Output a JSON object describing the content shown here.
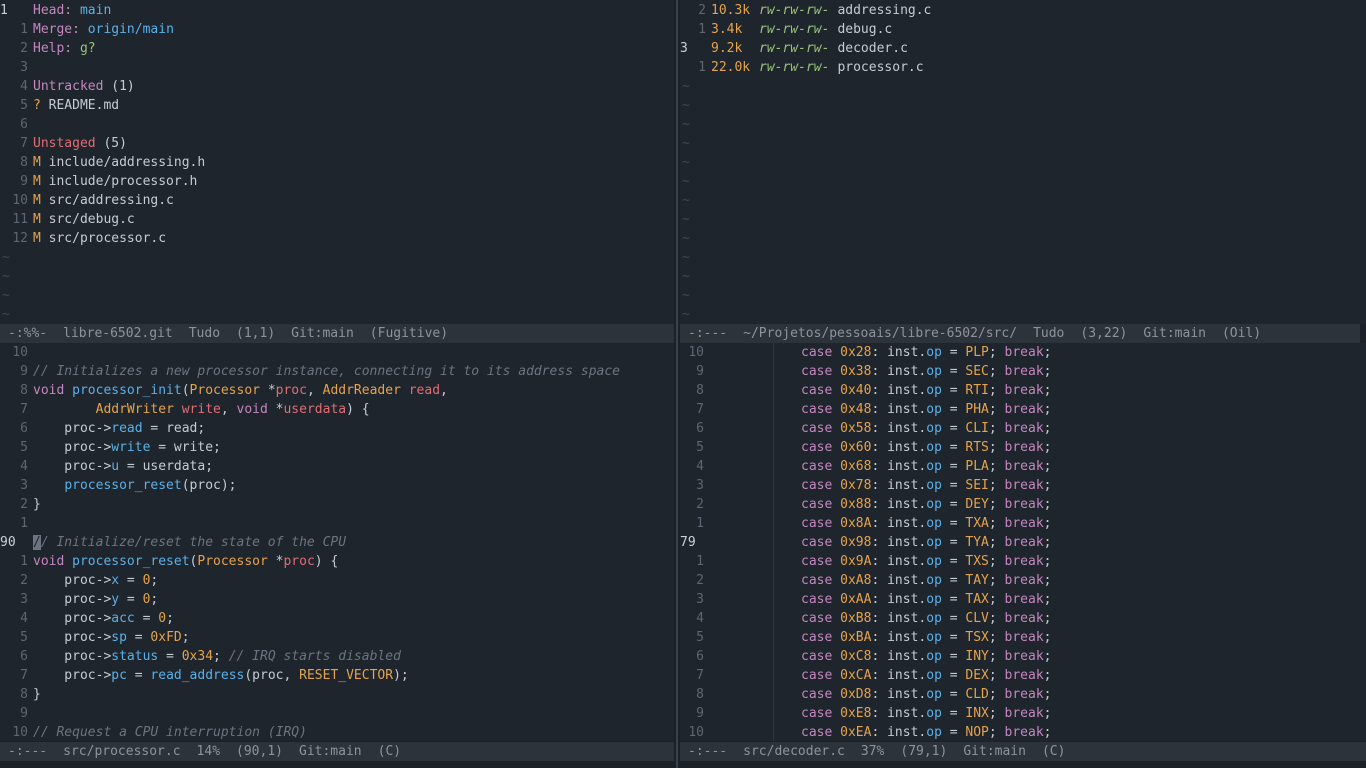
{
  "git_status": {
    "lines": [
      {
        "num": "1",
        "current": true,
        "parts": [
          [
            "c-key",
            "Head: "
          ],
          [
            "c-blue",
            "main"
          ]
        ]
      },
      {
        "num": "1",
        "parts": [
          [
            "c-key",
            "Merge: "
          ],
          [
            "c-blue",
            "origin/main"
          ]
        ]
      },
      {
        "num": "2",
        "parts": [
          [
            "c-key",
            "Help: "
          ],
          [
            "c-green",
            "g?"
          ]
        ]
      },
      {
        "num": "3",
        "parts": []
      },
      {
        "num": "4",
        "parts": [
          [
            "c-key",
            "Untracked "
          ],
          [
            "code-text",
            "(1)"
          ]
        ]
      },
      {
        "num": "5",
        "parts": [
          [
            "c-orange",
            "? "
          ],
          [
            "code-text",
            "README.md"
          ]
        ]
      },
      {
        "num": "6",
        "parts": []
      },
      {
        "num": "7",
        "parts": [
          [
            "c-red",
            "Unstaged "
          ],
          [
            "code-text",
            "(5)"
          ]
        ]
      },
      {
        "num": "8",
        "parts": [
          [
            "c-orange",
            "M "
          ],
          [
            "code-text",
            "include/addressing.h"
          ]
        ]
      },
      {
        "num": "9",
        "parts": [
          [
            "c-orange",
            "M "
          ],
          [
            "code-text",
            "include/processor.h"
          ]
        ]
      },
      {
        "num": "10",
        "parts": [
          [
            "c-orange",
            "M "
          ],
          [
            "code-text",
            "src/addressing.c"
          ]
        ]
      },
      {
        "num": "11",
        "parts": [
          [
            "c-orange",
            "M "
          ],
          [
            "code-text",
            "src/debug.c"
          ]
        ]
      },
      {
        "num": "12",
        "parts": [
          [
            "c-orange",
            "M "
          ],
          [
            "code-text",
            "src/processor.c"
          ]
        ]
      }
    ],
    "tildes": 4,
    "modeline": [
      "-:%%-",
      "libre-6502.git",
      "Tudo",
      "(1,1)",
      "Git:main",
      "(Fugitive)"
    ]
  },
  "oil": {
    "lines": [
      {
        "num": "2",
        "size": "10.3k",
        "perm": "rw-rw-rw-",
        "name": "addressing.c"
      },
      {
        "num": "1",
        "size": "3.4k",
        "perm": "rw-rw-rw-",
        "name": "debug.c"
      },
      {
        "num": "3",
        "current": true,
        "size": "9.2k",
        "perm": "rw-rw-rw-",
        "name": "decoder.c"
      },
      {
        "num": "1",
        "size": "22.0k",
        "perm": "rw-rw-rw-",
        "name": "processor.c"
      }
    ],
    "tildes": 13,
    "modeline": [
      "-:---",
      "~/Projetos/pessoais/libre-6502/src/",
      "Tudo",
      "(3,22)",
      "Git:main",
      "(Oil)"
    ]
  },
  "processor": {
    "lines": [
      {
        "num": "10",
        "parts": []
      },
      {
        "num": "9",
        "parts": [
          [
            "c-comment",
            "// Initializes a new processor instance, connecting it to its address space"
          ]
        ]
      },
      {
        "num": "8",
        "parts": [
          [
            "c-kw",
            "void "
          ],
          [
            "c-fn",
            "processor_init"
          ],
          [
            "code-text",
            "("
          ],
          [
            "c-type",
            "Processor "
          ],
          [
            "code-text",
            "*"
          ],
          [
            "c-param",
            "proc"
          ],
          [
            "code-text",
            ", "
          ],
          [
            "c-type",
            "AddrReader "
          ],
          [
            "c-param",
            "read"
          ],
          [
            "code-text",
            ","
          ]
        ]
      },
      {
        "num": "7",
        "parts": [
          [
            "code-text",
            "        "
          ],
          [
            "c-type",
            "AddrWriter "
          ],
          [
            "c-param",
            "write"
          ],
          [
            "code-text",
            ", "
          ],
          [
            "c-kw",
            "void "
          ],
          [
            "code-text",
            "*"
          ],
          [
            "c-param",
            "userdata"
          ],
          [
            "code-text",
            ") {"
          ]
        ]
      },
      {
        "num": "6",
        "parts": [
          [
            "code-text",
            "    proc->"
          ],
          [
            "c-field",
            "read"
          ],
          [
            "code-text",
            " = read;"
          ]
        ]
      },
      {
        "num": "5",
        "parts": [
          [
            "code-text",
            "    proc->"
          ],
          [
            "c-field",
            "write"
          ],
          [
            "code-text",
            " = write;"
          ]
        ]
      },
      {
        "num": "4",
        "parts": [
          [
            "code-text",
            "    proc->"
          ],
          [
            "c-field",
            "u"
          ],
          [
            "code-text",
            " = userdata;"
          ]
        ]
      },
      {
        "num": "3",
        "parts": [
          [
            "code-text",
            "    "
          ],
          [
            "c-fn",
            "processor_reset"
          ],
          [
            "code-text",
            "(proc);"
          ]
        ]
      },
      {
        "num": "2",
        "parts": [
          [
            "code-text",
            "}"
          ]
        ]
      },
      {
        "num": "1",
        "parts": []
      },
      {
        "num": "90",
        "current": true,
        "parts": [
          [
            "cursor-block",
            "/"
          ],
          [
            "c-comment",
            "/ Initialize/reset the state of the CPU"
          ]
        ]
      },
      {
        "num": "1",
        "parts": [
          [
            "c-kw",
            "void "
          ],
          [
            "c-fn",
            "processor_reset"
          ],
          [
            "code-text",
            "("
          ],
          [
            "c-type",
            "Processor "
          ],
          [
            "code-text",
            "*"
          ],
          [
            "c-param",
            "proc"
          ],
          [
            "code-text",
            ") {"
          ]
        ]
      },
      {
        "num": "2",
        "parts": [
          [
            "code-text",
            "    proc->"
          ],
          [
            "c-field",
            "x"
          ],
          [
            "code-text",
            " = "
          ],
          [
            "c-num",
            "0"
          ],
          [
            "code-text",
            ";"
          ]
        ]
      },
      {
        "num": "3",
        "parts": [
          [
            "code-text",
            "    proc->"
          ],
          [
            "c-field",
            "y"
          ],
          [
            "code-text",
            " = "
          ],
          [
            "c-num",
            "0"
          ],
          [
            "code-text",
            ";"
          ]
        ]
      },
      {
        "num": "4",
        "parts": [
          [
            "code-text",
            "    proc->"
          ],
          [
            "c-field",
            "acc"
          ],
          [
            "code-text",
            " = "
          ],
          [
            "c-num",
            "0"
          ],
          [
            "code-text",
            ";"
          ]
        ]
      },
      {
        "num": "5",
        "parts": [
          [
            "code-text",
            "    proc->"
          ],
          [
            "c-field",
            "sp"
          ],
          [
            "code-text",
            " = "
          ],
          [
            "c-num",
            "0xFD"
          ],
          [
            "code-text",
            ";"
          ]
        ]
      },
      {
        "num": "6",
        "parts": [
          [
            "code-text",
            "    proc->"
          ],
          [
            "c-field",
            "status"
          ],
          [
            "code-text",
            " = "
          ],
          [
            "c-num",
            "0x34"
          ],
          [
            "code-text",
            "; "
          ],
          [
            "c-comment",
            "// IRQ starts disabled"
          ]
        ]
      },
      {
        "num": "7",
        "parts": [
          [
            "code-text",
            "    proc->"
          ],
          [
            "c-field",
            "pc"
          ],
          [
            "code-text",
            " = "
          ],
          [
            "c-fn",
            "read_address"
          ],
          [
            "code-text",
            "(proc, "
          ],
          [
            "c-const",
            "RESET_VECTOR"
          ],
          [
            "code-text",
            ");"
          ]
        ]
      },
      {
        "num": "8",
        "parts": [
          [
            "code-text",
            "}"
          ]
        ]
      },
      {
        "num": "9",
        "parts": []
      },
      {
        "num": "10",
        "parts": [
          [
            "c-comment",
            "// Request a CPU interruption (IRQ)"
          ]
        ]
      }
    ],
    "modeline": [
      "-:---",
      "src/processor.c",
      "14%",
      "(90,1)",
      "Git:main",
      "(C)"
    ]
  },
  "decoder": {
    "lines": [
      {
        "num": "10",
        "code": "0x28",
        "op": "PLP"
      },
      {
        "num": "9",
        "code": "0x38",
        "op": "SEC"
      },
      {
        "num": "8",
        "code": "0x40",
        "op": "RTI"
      },
      {
        "num": "7",
        "code": "0x48",
        "op": "PHA"
      },
      {
        "num": "6",
        "code": "0x58",
        "op": "CLI"
      },
      {
        "num": "5",
        "code": "0x60",
        "op": "RTS"
      },
      {
        "num": "4",
        "code": "0x68",
        "op": "PLA"
      },
      {
        "num": "3",
        "code": "0x78",
        "op": "SEI"
      },
      {
        "num": "2",
        "code": "0x88",
        "op": "DEY"
      },
      {
        "num": "1",
        "code": "0x8A",
        "op": "TXA"
      },
      {
        "num": "79",
        "current": true,
        "code": "0x98",
        "op": "TYA"
      },
      {
        "num": "1",
        "code": "0x9A",
        "op": "TXS"
      },
      {
        "num": "2",
        "code": "0xA8",
        "op": "TAY"
      },
      {
        "num": "3",
        "code": "0xAA",
        "op": "TAX"
      },
      {
        "num": "4",
        "code": "0xB8",
        "op": "CLV"
      },
      {
        "num": "5",
        "code": "0xBA",
        "op": "TSX"
      },
      {
        "num": "6",
        "code": "0xC8",
        "op": "INY"
      },
      {
        "num": "7",
        "code": "0xCA",
        "op": "DEX"
      },
      {
        "num": "8",
        "code": "0xD8",
        "op": "CLD"
      },
      {
        "num": "9",
        "code": "0xE8",
        "op": "INX"
      },
      {
        "num": "10",
        "code": "0xEA",
        "op": "NOP"
      }
    ],
    "tokens": {
      "case": "case ",
      "inst": "inst.",
      "field": "op",
      "eq": " = ",
      "brk": "break",
      "semi": ";",
      "colon": ": "
    },
    "modeline": [
      "-:---",
      "src/decoder.c",
      "37%",
      "(79,1)",
      "Git:main",
      "(C)"
    ]
  }
}
